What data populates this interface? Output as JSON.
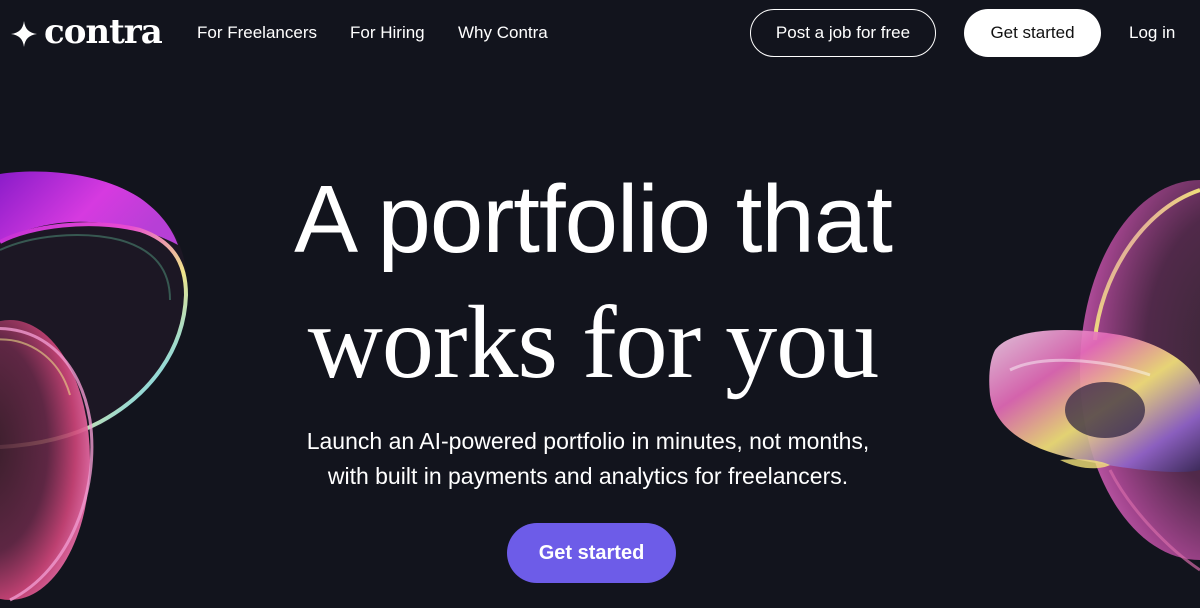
{
  "brand": {
    "name": "contra",
    "icon": "sparkle-star-icon"
  },
  "nav": {
    "links": [
      {
        "label": "For Freelancers"
      },
      {
        "label": "For Hiring"
      },
      {
        "label": "Why Contra"
      }
    ],
    "post_job_label": "Post a job for free",
    "get_started_label": "Get started",
    "login_label": "Log in"
  },
  "hero": {
    "title_line1": "A portfolio that",
    "title_line2": "works for you",
    "subtitle_line1": "Launch an AI-powered portfolio in minutes, not months,",
    "subtitle_line2": "with built in payments and analytics for freelancers.",
    "cta_label": "Get started"
  },
  "colors": {
    "background": "#12141d",
    "accent": "#6d5ce8",
    "text": "#ffffff"
  }
}
